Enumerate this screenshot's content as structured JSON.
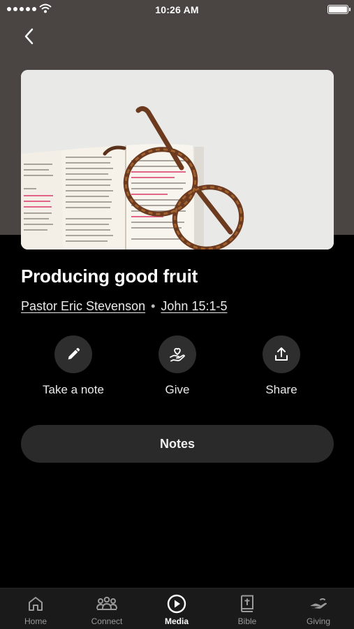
{
  "status_bar": {
    "time": "10:26 AM"
  },
  "sermon": {
    "title": "Producing good fruit",
    "speaker": "Pastor Eric Stevenson",
    "separator": "•",
    "scripture": "John 15:1-5"
  },
  "actions": [
    {
      "label": "Take a note",
      "icon": "pencil-icon"
    },
    {
      "label": "Give",
      "icon": "heart-hand-icon"
    },
    {
      "label": "Share",
      "icon": "share-icon"
    }
  ],
  "notes_button": "Notes",
  "tabs": [
    {
      "label": "Home",
      "icon": "home-icon",
      "active": false
    },
    {
      "label": "Connect",
      "icon": "people-icon",
      "active": false
    },
    {
      "label": "Media",
      "icon": "play-icon",
      "active": true
    },
    {
      "label": "Bible",
      "icon": "bible-icon",
      "active": false
    },
    {
      "label": "Giving",
      "icon": "giving-icon",
      "active": false
    }
  ],
  "colors": {
    "header_band": "#4a4442",
    "background": "#000000",
    "button_bg": "#2a2a2a",
    "tab_active": "#ffffff",
    "tab_inactive": "#9a9a9a"
  }
}
